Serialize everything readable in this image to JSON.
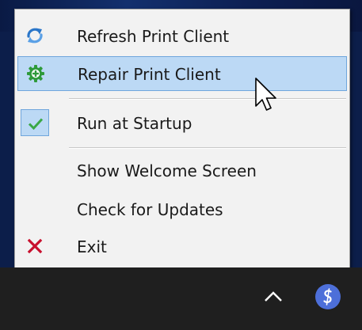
{
  "menu": {
    "items": [
      {
        "label": "Refresh Print Client",
        "icon": "refresh-icon",
        "highlighted": false
      },
      {
        "label": "Repair Print Client",
        "icon": "gear-icon",
        "highlighted": true
      },
      {
        "label": "Run at Startup",
        "icon": "checkmark-icon",
        "checked": true
      },
      {
        "label": "Show Welcome Screen",
        "icon": ""
      },
      {
        "label": "Check for Updates",
        "icon": ""
      },
      {
        "label": "Exit",
        "icon": "close-icon"
      }
    ]
  },
  "taskbar": {
    "tray_chevron_icon": "chevron-up-icon",
    "tray_app_icon": "print-client-tray-icon"
  },
  "colors": {
    "highlight_fill": "#bcd9f5",
    "highlight_border": "#6fa6dc",
    "refresh_icon": "#2a76c9",
    "gear_icon": "#2e9a3a",
    "check_icon": "#3aa845",
    "exit_icon": "#c8102e",
    "taskbar": "#1f1f1f",
    "tray_app": "#4d6fd9"
  }
}
